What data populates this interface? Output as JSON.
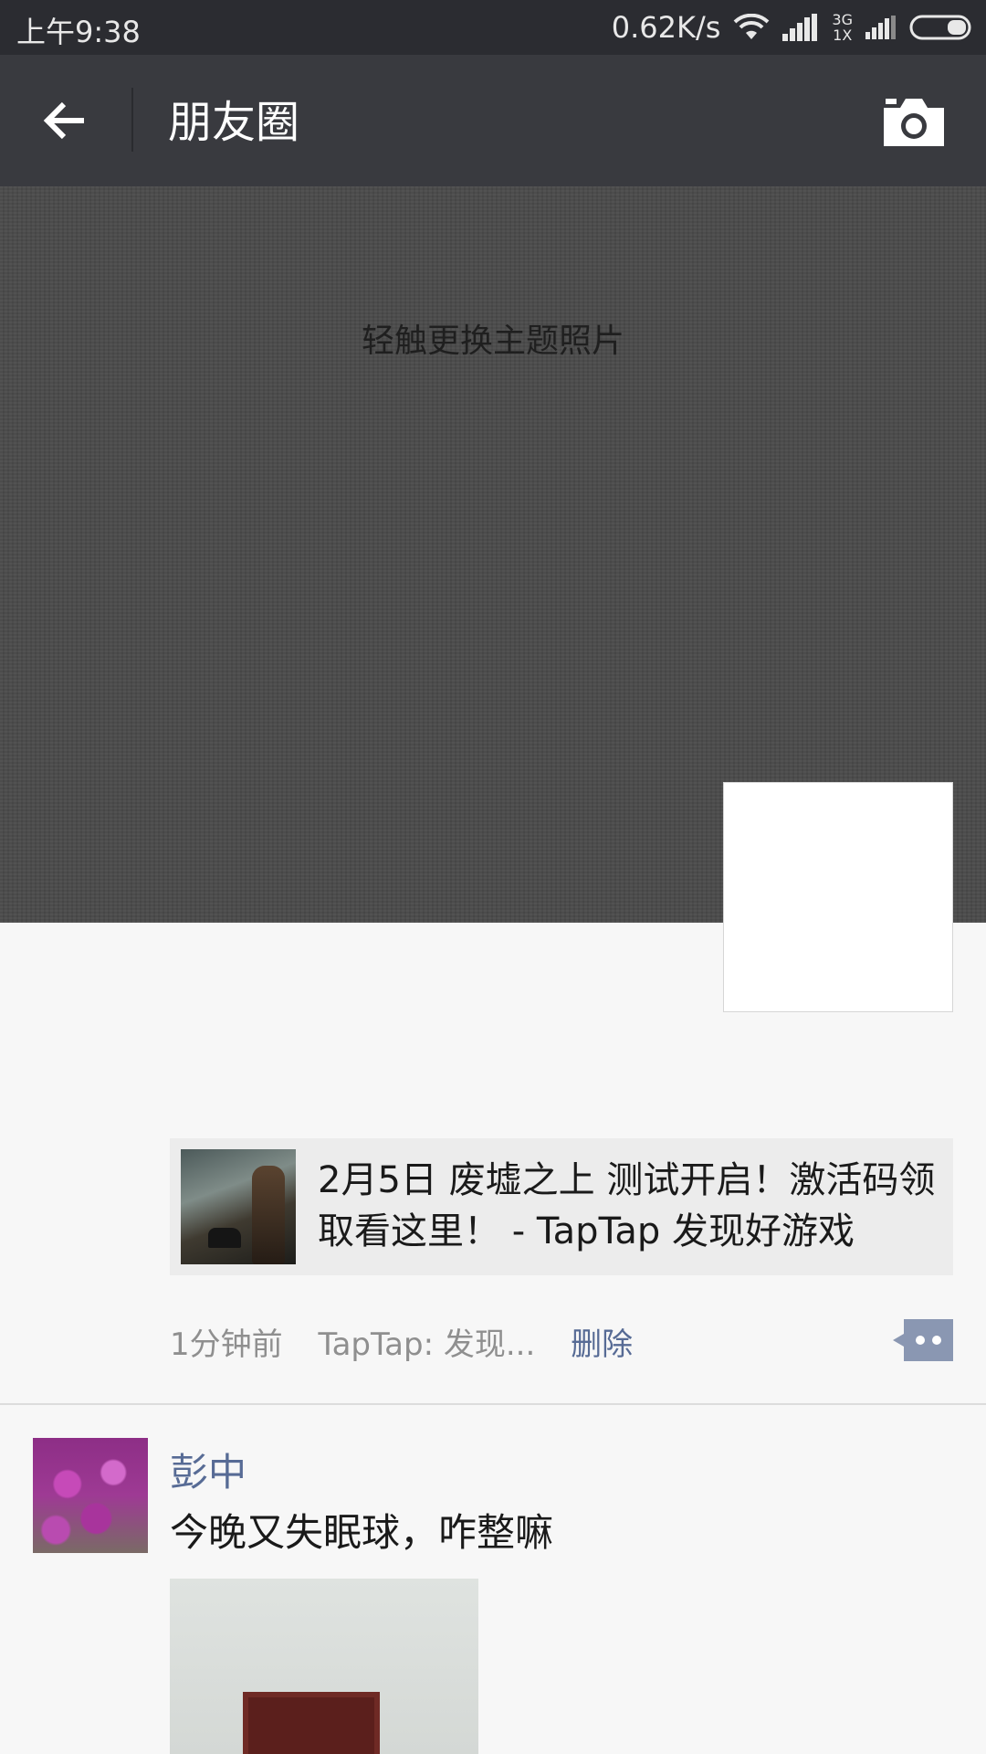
{
  "status_bar": {
    "time": "上午9:38",
    "net_speed": "0.62K/s",
    "net_type_top": "3G",
    "net_type_bottom": "1X"
  },
  "header": {
    "title": "朋友圈",
    "back_icon": "arrow-left-icon",
    "camera_icon": "camera-icon"
  },
  "cover": {
    "hint": "轻触更换主题照片"
  },
  "posts": [
    {
      "link_title": "2月5日 废墟之上 测试开启！激活码领取看这里！ - TapTap 发现好游戏",
      "time": "1分钟前",
      "source": "TapTap: 发现...",
      "delete_label": "删除"
    },
    {
      "author": "彭中",
      "text": "今晚又失眠球，咋整嘛"
    }
  ],
  "colors": {
    "status_bar": "#2b2c31",
    "title_bar": "#393a3f",
    "link_blue": "#576b95",
    "background": "#f7f7f7"
  }
}
